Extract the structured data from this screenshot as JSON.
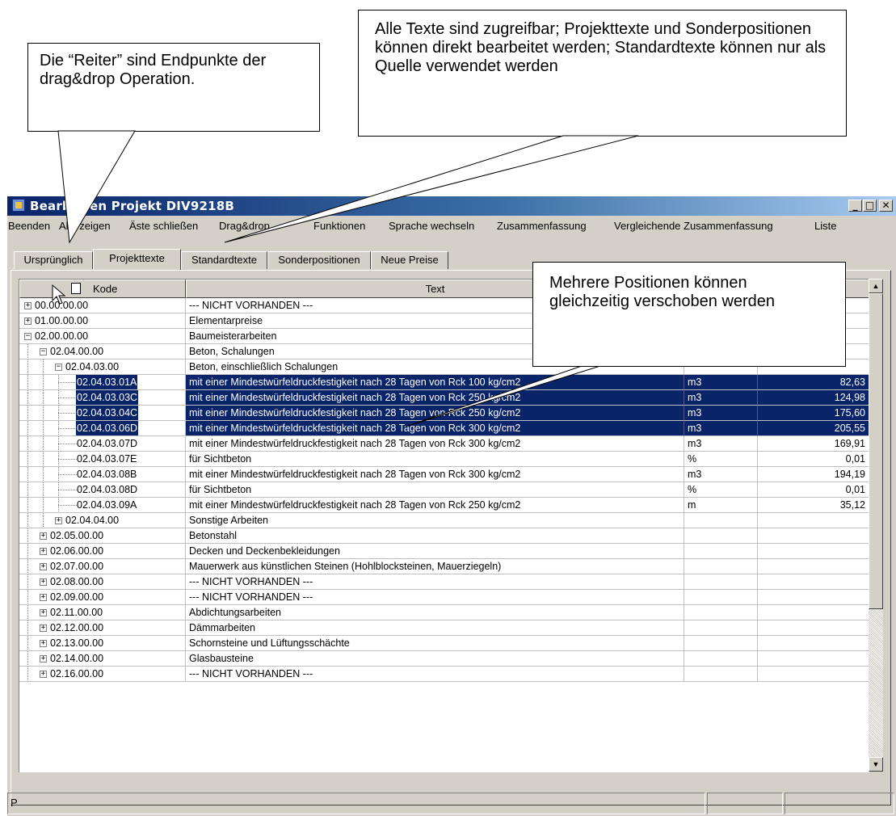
{
  "callouts": [
    {
      "text": "Die “Reiter” sind Endpunkte der drag&drop Operation."
    },
    {
      "text": "Alle Texte sind zugreifbar; Projekttexte und Sonderpositionen können direkt bearbeitet werden; Standardtexte können nur als Quelle verwendet werden"
    },
    {
      "text": "Mehrere Positionen können gleichzeitig verschoben werden"
    }
  ],
  "window": {
    "title": "Bearbeiten Projekt DIV9218B",
    "minimize": "_",
    "maximize": "□",
    "close": "✕"
  },
  "menu": [
    "Beenden",
    "Alle zeigen",
    "Äste schließen",
    "Drag&drop",
    "Funktionen",
    "Sprache wechseln",
    "Zusammenfassung",
    "Vergleichende Zusammenfassung",
    "Liste"
  ],
  "tabs": [
    {
      "label": "Ursprünglich",
      "active": false
    },
    {
      "label": "Projekttexte",
      "active": true
    },
    {
      "label": "Standardtexte",
      "active": false
    },
    {
      "label": "Sonderpositionen",
      "active": false
    },
    {
      "label": "Neue Preise",
      "active": false
    }
  ],
  "grid": {
    "headers": {
      "code": "Kode",
      "text": "Text",
      "unit": "",
      "price": ""
    },
    "rows": [
      {
        "code": "00.00.00.00",
        "text": "--- NICHT VORHANDEN ---",
        "unit": "",
        "price": "",
        "level": 0,
        "expander": "+",
        "selected": false
      },
      {
        "code": "01.00.00.00",
        "text": "Elementarpreise",
        "unit": "",
        "price": "",
        "level": 0,
        "expander": "+",
        "selected": false
      },
      {
        "code": "02.00.00.00",
        "text": "Baumeisterarbeiten",
        "unit": "",
        "price": "",
        "level": 0,
        "expander": "-",
        "selected": false
      },
      {
        "code": "02.04.00.00",
        "text": "Beton, Schalungen",
        "unit": "",
        "price": "",
        "level": 1,
        "expander": "-",
        "selected": false
      },
      {
        "code": "02.04.03.00",
        "text": "Beton, einschließlich Schalungen",
        "unit": "",
        "price": "",
        "level": 2,
        "expander": "-",
        "selected": false
      },
      {
        "code": "02.04.03.01A",
        "text": "mit einer Mindestwürfeldruckfestigkeit nach 28 Tagen von Rck 100 kg/cm2",
        "unit": "m3",
        "price": "82,63",
        "level": 3,
        "expander": "",
        "selected": true
      },
      {
        "code": "02.04.03.03C",
        "text": "mit einer Mindestwürfeldruckfestigkeit nach 28 Tagen von Rck 250 kg/cm2",
        "unit": "m3",
        "price": "124,98",
        "level": 3,
        "expander": "",
        "selected": true
      },
      {
        "code": "02.04.03.04C",
        "text": "mit einer Mindestwürfeldruckfestigkeit nach 28 Tagen von Rck 250 kg/cm2",
        "unit": "m3",
        "price": "175,60",
        "level": 3,
        "expander": "",
        "selected": true
      },
      {
        "code": "02.04.03.06D",
        "text": "mit einer Mindestwürfeldruckfestigkeit nach 28 Tagen von Rck 300 kg/cm2",
        "unit": "m3",
        "price": "205,55",
        "level": 3,
        "expander": "",
        "selected": true
      },
      {
        "code": "02.04.03.07D",
        "text": "mit einer Mindestwürfeldruckfestigkeit nach 28 Tagen von Rck 300 kg/cm2",
        "unit": "m3",
        "price": "169,91",
        "level": 3,
        "expander": "",
        "selected": false
      },
      {
        "code": "02.04.03.07E",
        "text": "für Sichtbeton",
        "unit": "%",
        "price": "0,01",
        "level": 3,
        "expander": "",
        "selected": false
      },
      {
        "code": "02.04.03.08B",
        "text": "mit einer Mindestwürfeldruckfestigkeit nach 28 Tagen von Rck 300 kg/cm2",
        "unit": "m3",
        "price": "194,19",
        "level": 3,
        "expander": "",
        "selected": false
      },
      {
        "code": "02.04.03.08D",
        "text": "für Sichtbeton",
        "unit": "%",
        "price": "0,01",
        "level": 3,
        "expander": "",
        "selected": false
      },
      {
        "code": "02.04.03.09A",
        "text": "mit einer Mindestwürfeldruckfestigkeit nach 28 Tagen von Rck 250 kg/cm2",
        "unit": "m",
        "price": "35,12",
        "level": 3,
        "expander": "",
        "selected": false
      },
      {
        "code": "02.04.04.00",
        "text": "Sonstige Arbeiten",
        "unit": "",
        "price": "",
        "level": 2,
        "expander": "+",
        "selected": false
      },
      {
        "code": "02.05.00.00",
        "text": "Betonstahl",
        "unit": "",
        "price": "",
        "level": 1,
        "expander": "+",
        "selected": false
      },
      {
        "code": "02.06.00.00",
        "text": "Decken und Deckenbekleidungen",
        "unit": "",
        "price": "",
        "level": 1,
        "expander": "+",
        "selected": false
      },
      {
        "code": "02.07.00.00",
        "text": "Mauerwerk aus künstlichen Steinen (Hohlblocksteinen, Mauerziegeln)",
        "unit": "",
        "price": "",
        "level": 1,
        "expander": "+",
        "selected": false
      },
      {
        "code": "02.08.00.00",
        "text": "--- NICHT VORHANDEN ---",
        "unit": "",
        "price": "",
        "level": 1,
        "expander": "+",
        "selected": false
      },
      {
        "code": "02.09.00.00",
        "text": "--- NICHT VORHANDEN ---",
        "unit": "",
        "price": "",
        "level": 1,
        "expander": "+",
        "selected": false
      },
      {
        "code": "02.11.00.00",
        "text": "Abdichtungsarbeiten",
        "unit": "",
        "price": "",
        "level": 1,
        "expander": "+",
        "selected": false
      },
      {
        "code": "02.12.00.00",
        "text": "Dämmarbeiten",
        "unit": "",
        "price": "",
        "level": 1,
        "expander": "+",
        "selected": false
      },
      {
        "code": "02.13.00.00",
        "text": "Schornsteine und Lüftungsschächte",
        "unit": "",
        "price": "",
        "level": 1,
        "expander": "+",
        "selected": false
      },
      {
        "code": "02.14.00.00",
        "text": "Glasbausteine",
        "unit": "",
        "price": "",
        "level": 1,
        "expander": "+",
        "selected": false
      },
      {
        "code": "02.16.00.00",
        "text": "--- NICHT VORHANDEN ---",
        "unit": "",
        "price": "",
        "level": 1,
        "expander": "+",
        "selected": false
      }
    ]
  },
  "scrollbar": {
    "up": "▲",
    "down": "▼"
  },
  "statusbar": {
    "text": "P"
  },
  "colors": {
    "selection": "#0a246a",
    "title_start": "#0a246a",
    "title_end": "#a6caf0",
    "chrome": "#d4d0c8"
  }
}
